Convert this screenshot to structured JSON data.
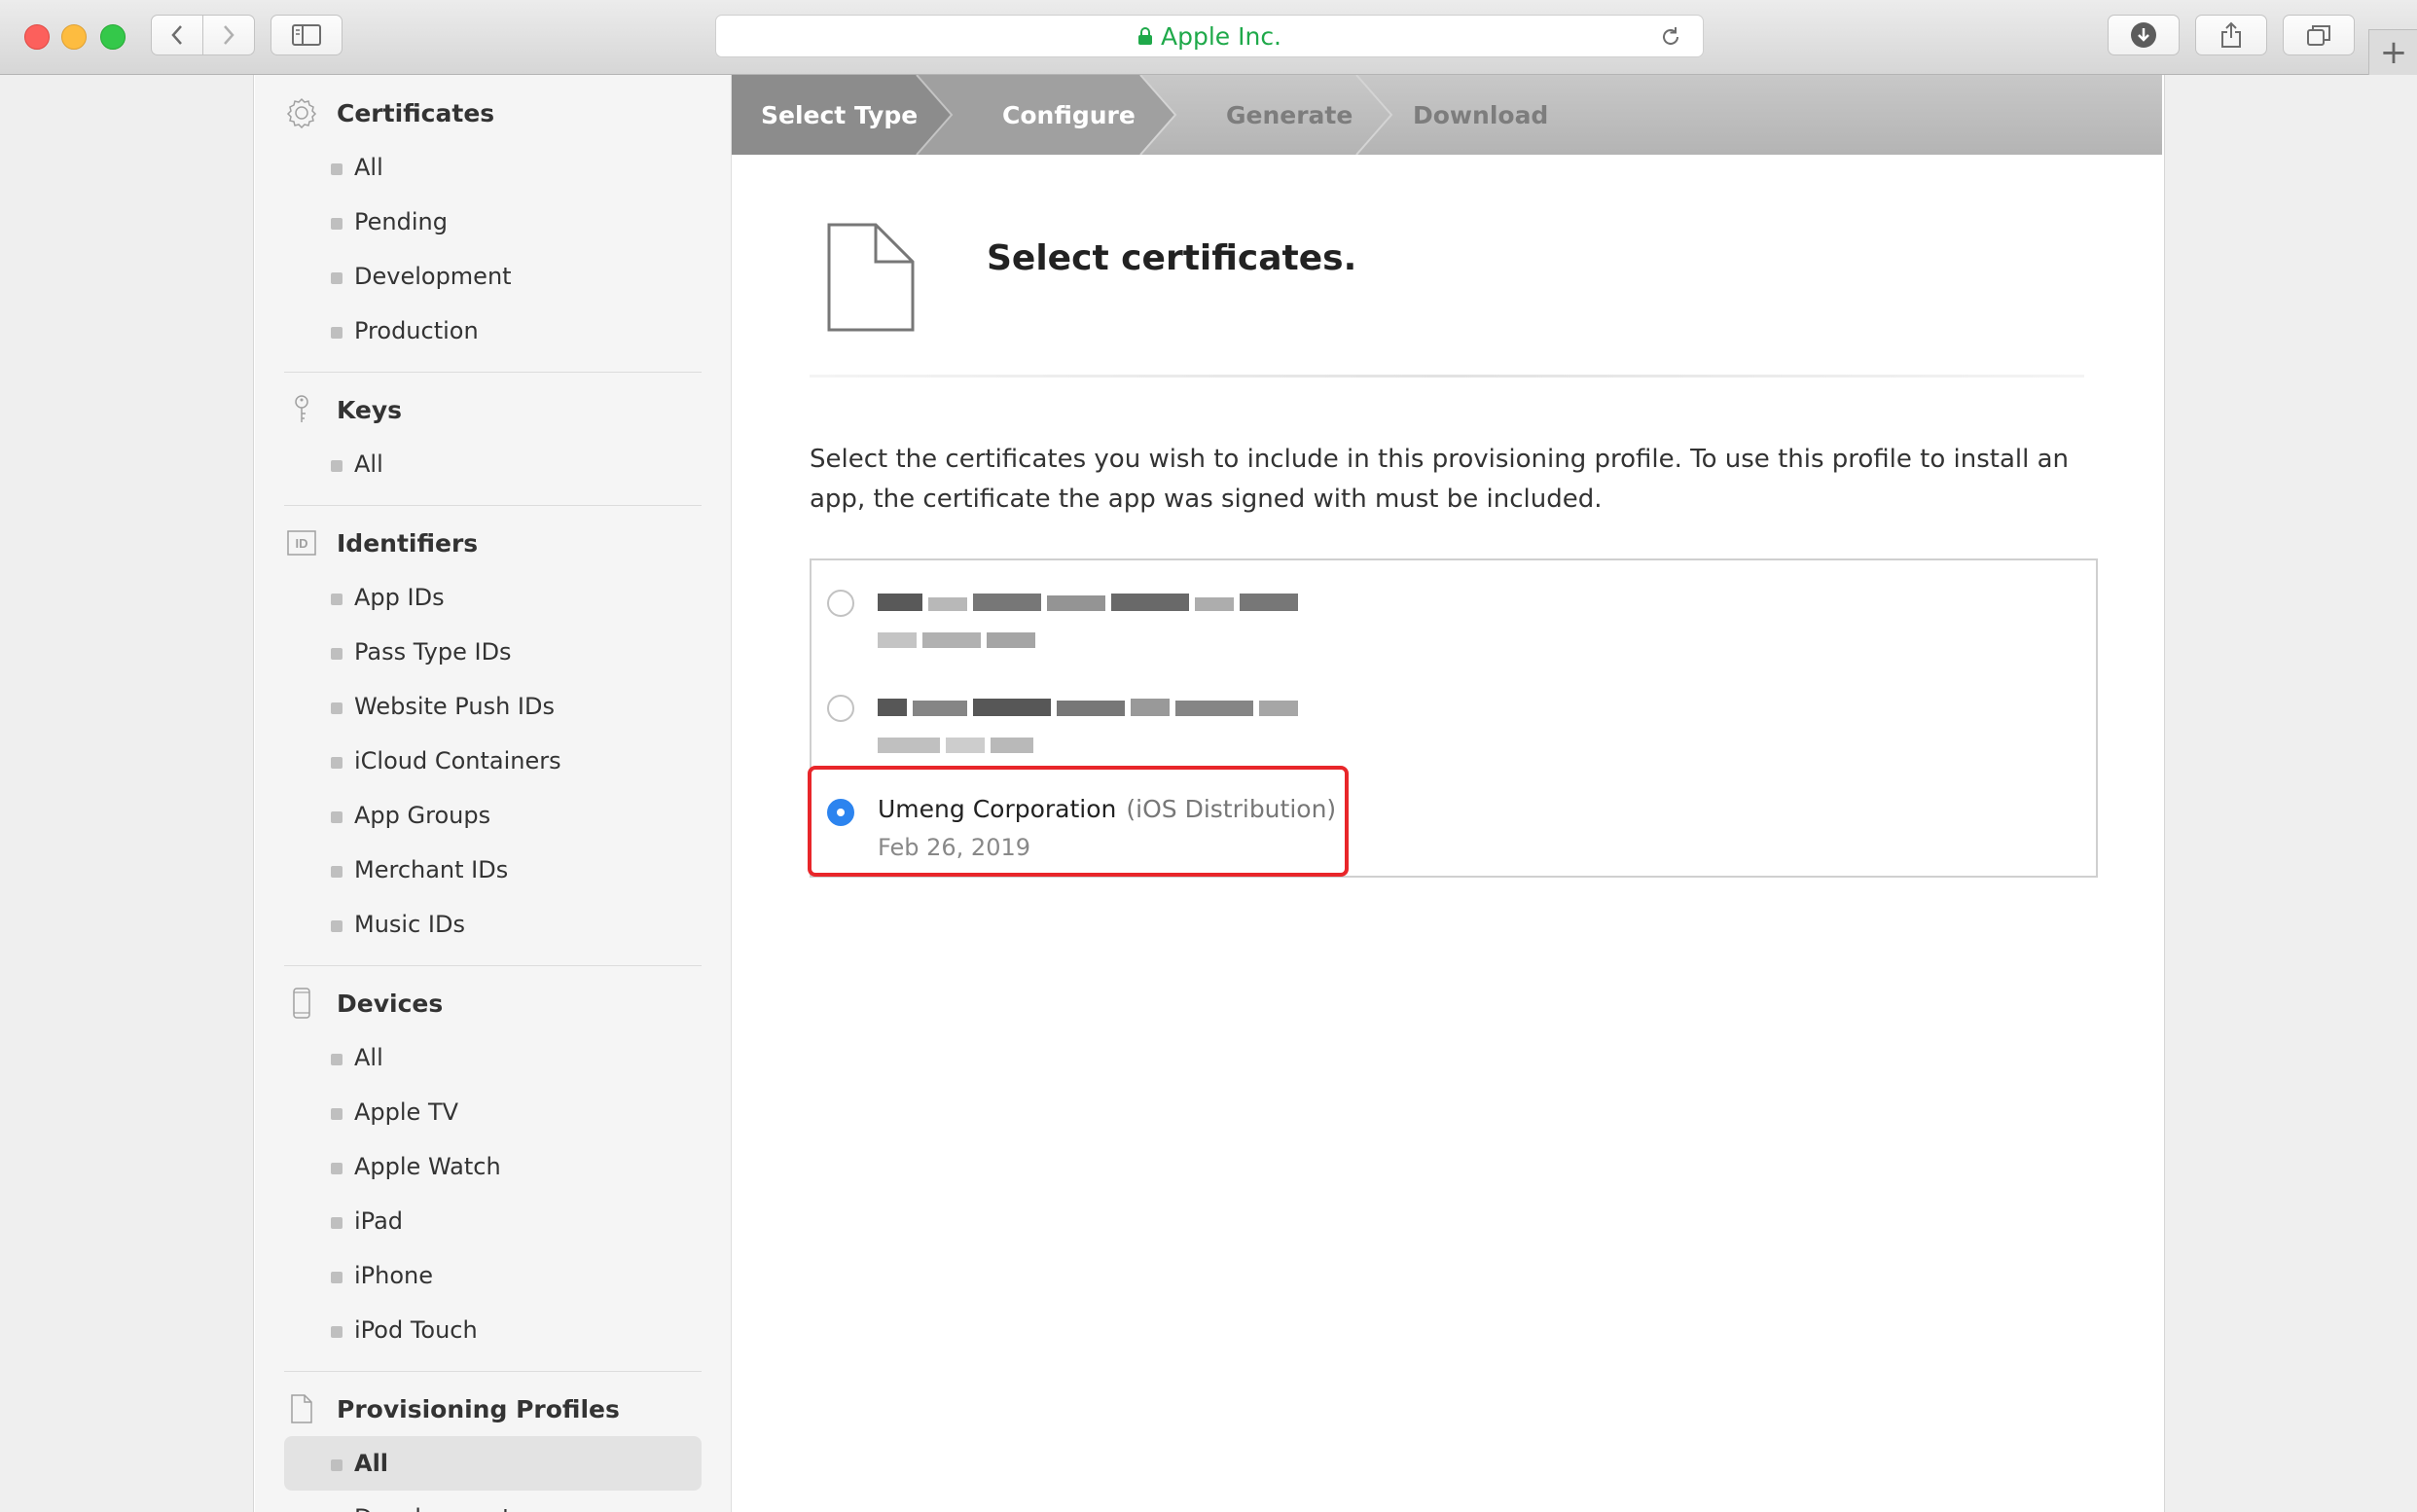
{
  "browser": {
    "address": "Apple Inc.",
    "secure": true
  },
  "sidebar": {
    "sections": [
      {
        "title": "Certificates",
        "icon": "certificate-icon",
        "items": [
          "All",
          "Pending",
          "Development",
          "Production"
        ]
      },
      {
        "title": "Keys",
        "icon": "key-icon",
        "items": [
          "All"
        ]
      },
      {
        "title": "Identifiers",
        "icon": "id-icon",
        "items": [
          "App IDs",
          "Pass Type IDs",
          "Website Push IDs",
          "iCloud Containers",
          "App Groups",
          "Merchant IDs",
          "Music IDs"
        ]
      },
      {
        "title": "Devices",
        "icon": "device-icon",
        "items": [
          "All",
          "Apple TV",
          "Apple Watch",
          "iPad",
          "iPhone",
          "iPod Touch"
        ]
      },
      {
        "title": "Provisioning Profiles",
        "icon": "document-icon",
        "items": [
          "All",
          "Development"
        ],
        "active_item": "All"
      }
    ]
  },
  "steps": [
    {
      "label": "Select Type",
      "state": "done"
    },
    {
      "label": "Configure",
      "state": "current"
    },
    {
      "label": "Generate",
      "state": "todo"
    },
    {
      "label": "Download",
      "state": "todo"
    }
  ],
  "main": {
    "title": "Select certificates.",
    "description": "Select the certificates you wish to include in this provisioning profile. To use this profile to install an app, the certificate the app was signed with must be included.",
    "certificates": [
      {
        "name": "",
        "type": "",
        "date": "",
        "obscured": true,
        "selected": false
      },
      {
        "name": "",
        "type": "",
        "date": "",
        "obscured": true,
        "selected": false
      },
      {
        "name": "Umeng Corporation",
        "type": "(iOS Distribution)",
        "date": "Feb 26, 2019",
        "obscured": false,
        "selected": true
      }
    ]
  },
  "colors": {
    "accent": "#2c84ef",
    "highlight": "#e8262a",
    "secure_green": "#1fa94a",
    "step_done": "#8c8c8c"
  }
}
